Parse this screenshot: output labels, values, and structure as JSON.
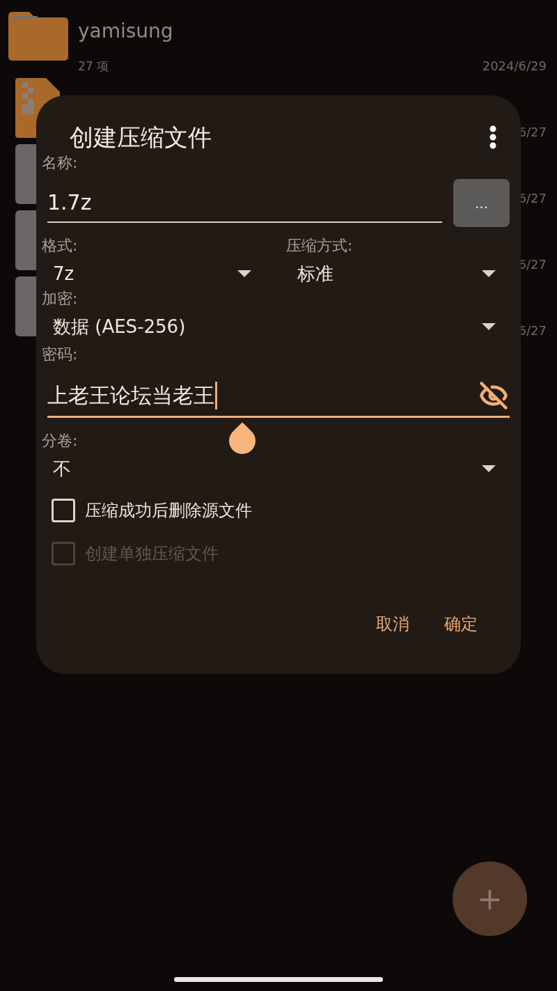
{
  "background_list": {
    "items": [
      {
        "kind": "folder",
        "name": "yamisung",
        "count": "27 项",
        "date": "2024/6/29"
      },
      {
        "kind": "archive",
        "date": "6/27"
      },
      {
        "kind": "file",
        "date": "6/27"
      },
      {
        "kind": "file",
        "date": "6/27"
      },
      {
        "kind": "file",
        "date": "6/27"
      }
    ]
  },
  "dialog": {
    "title": "创建压缩文件",
    "name": {
      "label": "名称:",
      "value": "1.7z",
      "browse": "..."
    },
    "format": {
      "label": "格式:",
      "value": "7z"
    },
    "method": {
      "label": "压缩方式:",
      "value": "标准"
    },
    "encryption": {
      "label": "加密:",
      "value": "数据 (AES-256)"
    },
    "password": {
      "label": "密码:",
      "value": "上老王论坛当老王",
      "focused": true
    },
    "split": {
      "label": "分卷:",
      "value": "不"
    },
    "options": [
      {
        "label": "压缩成功后删除源文件",
        "checked": false,
        "disabled": false
      },
      {
        "label": "创建单独压缩文件",
        "checked": false,
        "disabled": true
      }
    ],
    "buttons": [
      "取消",
      "确定"
    ]
  },
  "fab": {
    "label": "+"
  }
}
